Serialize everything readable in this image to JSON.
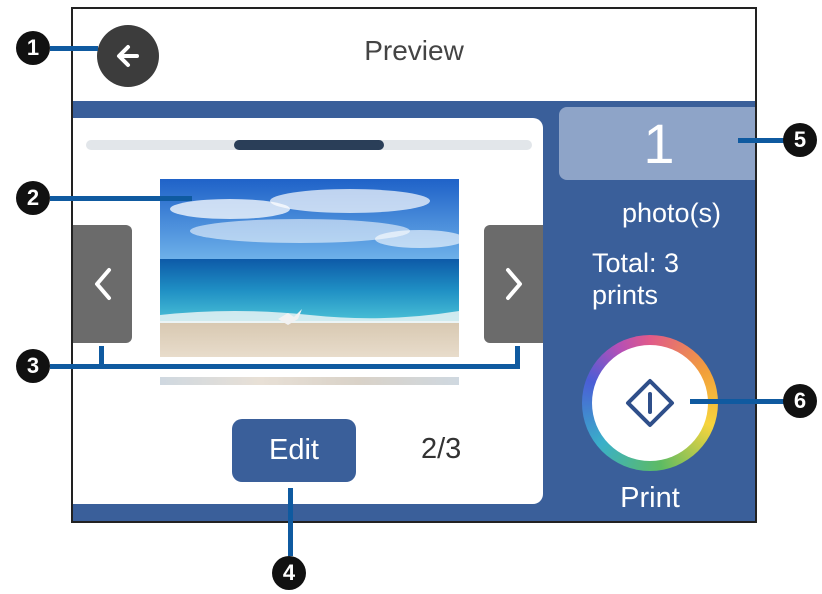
{
  "title": "Preview",
  "back_icon": "arrow-left-icon",
  "page_counter": "2/3",
  "edit_label": "Edit",
  "copies": {
    "value": "1",
    "unit_label": "photo(s)"
  },
  "total": {
    "line1": "Total: 3",
    "line2": "prints"
  },
  "print_label": "Print",
  "scroll_position": 0.34,
  "callouts": [
    "1",
    "2",
    "3",
    "4",
    "5",
    "6"
  ],
  "colors": {
    "accent": "#3a5f9a",
    "copies_box": "#8ea4c8",
    "callout_line": "#0f5aa0",
    "nav_button": "#6b6b6b"
  }
}
